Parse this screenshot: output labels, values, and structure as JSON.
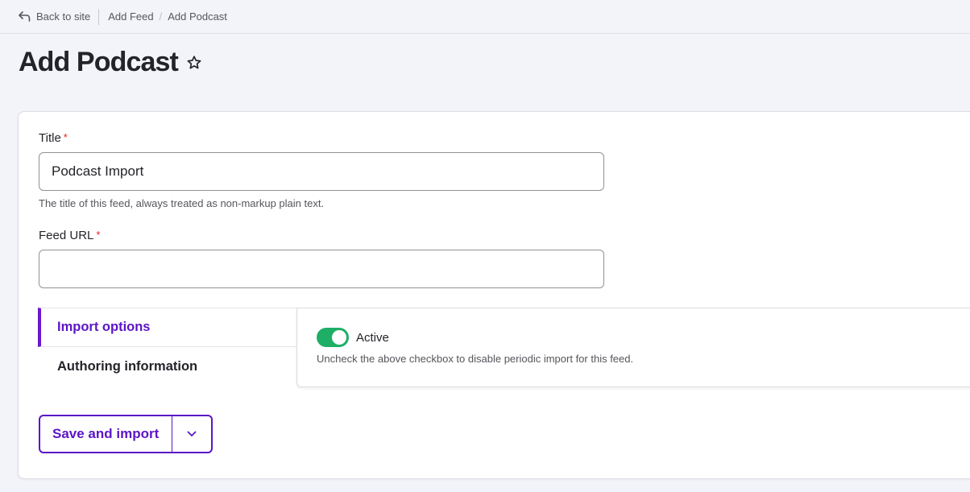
{
  "topbar": {
    "back_label": "Back to site",
    "breadcrumbs": [
      "Add Feed",
      "Add Podcast"
    ],
    "separator": "/"
  },
  "page": {
    "title": "Add Podcast"
  },
  "form": {
    "title_field": {
      "label": "Title",
      "required_mark": "*",
      "value": "Podcast Import",
      "help": "The title of this feed, always treated as non-markup plain text."
    },
    "url_field": {
      "label": "Feed URL",
      "required_mark": "*",
      "value": "",
      "placeholder": ""
    },
    "tabs": [
      {
        "label": "Import options",
        "active": true
      },
      {
        "label": "Authoring information",
        "active": false
      }
    ],
    "import_options": {
      "toggle_label": "Active",
      "toggle_on": true,
      "help": "Uncheck the above checkbox to disable periodic import for this feed."
    },
    "actions": {
      "save_label": "Save and import"
    }
  },
  "colors": {
    "accent": "#5b15c5",
    "toggle_on": "#1eae66",
    "required": "#d72222"
  }
}
